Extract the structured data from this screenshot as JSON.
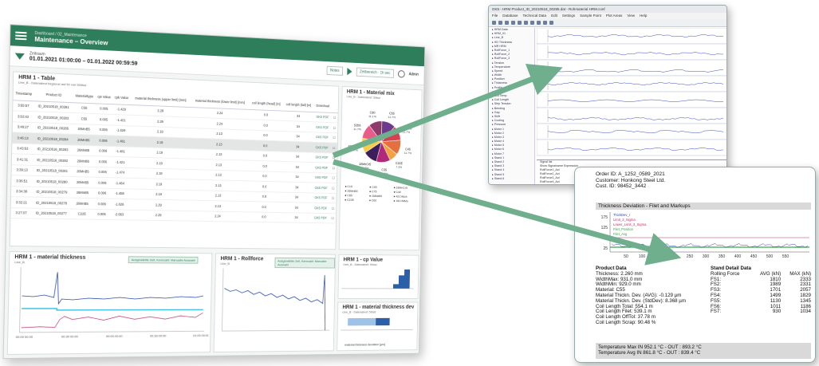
{
  "dashboard": {
    "topbar": {
      "subtitle": "Dashboard / 02_Maintenance",
      "title": "Maintenance – Overview"
    },
    "filter": {
      "label": "Zeitraum",
      "value": "01.01.2021 01:00:00 – 01.01.2022 00:59:59",
      "notes_label": "Notes",
      "time_label": "Zeitbereich · 1h sec",
      "user_label": "Admin"
    },
    "table_panel": {
      "title": "HRM 1 - Table",
      "subtitle": "Line_B - Datenabruf begrenzt auf 50 von 500tsd",
      "edit_label": "Bearbeiten",
      "columns": [
        "Timestamp",
        "Product ID",
        "Materialtype",
        "cpt Value",
        "cpk Value",
        "material thickness (upper limit) [mm]",
        "material thickness (lower limit) [mm]",
        "coil length (head) [m]",
        "coil length (tail) [m]",
        "Download",
        ""
      ],
      "rows": [
        [
          "3:55:57",
          "ID_20210518_00281",
          "C55",
          "0.005",
          "-1.429",
          "2.29",
          "2.24",
          "0.0",
          "34",
          "GK5 PDF",
          "☐"
        ],
        [
          "3:53:42",
          "ID_20210518_00283",
          "C55",
          "0.005",
          "-1.421",
          "2.29",
          "2.24",
          "0.0",
          "34",
          "GK5 PDF",
          "☐"
        ],
        [
          "3:48:27",
          "ID_20210518_00285",
          "26MnB5",
          "0.006",
          "-1.629",
          "2.19",
          "2.13",
          "0.0",
          "34",
          "GK5 PDF",
          "☐"
        ],
        [
          "3:46:13",
          "ID_20210518_00284",
          "26MnB5",
          "0.006",
          "-1.461",
          "2.19",
          "2.13",
          "0.0",
          "34",
          "GK5 PDF",
          "☐"
        ],
        [
          "3:43:53",
          "ID_20210518_00283",
          "26MnB5",
          "0.006",
          "-1.481",
          "2.19",
          "2.13",
          "0.0",
          "34",
          "GK5 PDF",
          "☐"
        ],
        [
          "3:41:31",
          "ID_20210518_00282",
          "26MnB5",
          "0.006",
          "-1.421",
          "2.19",
          "2.13",
          "0.0",
          "34",
          "GK5 PDF",
          "☐"
        ],
        [
          "3:39:13",
          "ID_20210518_00281",
          "26MnB5",
          "0.006",
          "-1.474",
          "2.19",
          "2.13",
          "0.0",
          "34",
          "GK5 PDF",
          "☐"
        ],
        [
          "3:36:51",
          "ID_20210518_00280",
          "26MnB5",
          "0.006",
          "-1.464",
          "2.19",
          "2.13",
          "0.0",
          "34",
          "GK5 PDF",
          "☐"
        ],
        [
          "3:34:38",
          "ID_20210518_00279",
          "26MnB5",
          "0.006",
          "-1.458",
          "2.19",
          "2.13",
          "0.0",
          "34",
          "GK5 PDF",
          "☐"
        ],
        [
          "3:32:21",
          "ID_20210518_00278",
          "26MnB5",
          "0.006",
          "-1.626",
          "2.29",
          "2.13",
          "0.0",
          "34",
          "GK5 PDF",
          "☐"
        ],
        [
          "3:27:07",
          "ID_20210518_00277",
          "C22E",
          "0.005",
          "-2.063",
          "2.29",
          "2.24",
          "0.0",
          "34",
          "GK5 PDF",
          "☐"
        ]
      ]
    },
    "pie_panel": {
      "title": "HRM 1 - Material mix",
      "subtitle": "Line_B - Datenabruf: 50tsd",
      "slices": [
        {
          "label": "C55",
          "value": 11.7,
          "color": "#6d3b8c"
        },
        {
          "label": "26MnB5",
          "value": 11.7,
          "color": "#d8404f"
        },
        {
          "label": "C45",
          "value": 11.7,
          "color": "#e66f3f"
        },
        {
          "label": "C22E",
          "value": 7.3,
          "color": "#f2a33f"
        },
        {
          "label": "C35",
          "value": 11.7,
          "color": "#b1287a"
        },
        {
          "label": "16MnCr5",
          "value": 11.7,
          "color": "#3c1f5a"
        },
        {
          "label": "42CrMo4",
          "value": 11.7,
          "color": "#f6cf4a"
        },
        {
          "label": "S355",
          "value": 11.7,
          "color": "#e85c8a"
        },
        {
          "label": "C60",
          "value": 11.1,
          "color": "#8e3b6b"
        }
      ],
      "legend": [
        "C15",
        "C45",
        "16MnCr5",
        "26MnB5",
        "C75",
        "C40",
        "C55",
        "16MnB5",
        "42CrMo4",
        "C22E",
        "C60",
        "18CrNiMo"
      ]
    },
    "mt_panel": {
      "title": "HRM 1 - material thickness",
      "subtitle": "Line_B",
      "filter_label": "Ausgewählte Zeit, Kennzahl: Manuelle Auswahl",
      "x_ticks": [
        "00:00 00:00",
        "00:30 00:00",
        "00:00 00:00",
        "00:30 00:00",
        "01:00 00:00"
      ]
    },
    "rf_panel": {
      "title": "HRM 1 - Rollforce",
      "subtitle": "Line_B",
      "filter_label": "Ausgewählte Zeit, Kennzahl: Manuelle Auswahl"
    },
    "cp_panel": {
      "title": "HRM 1 - cp Value",
      "subtitle": "Line_B - Datenabruf: 50tsd"
    },
    "td_panel": {
      "title": "HRM 1 - material thickness dev",
      "subtitle": "Line_B - Datenabruf: 50tsd",
      "legend": "material thickness deviation [µm]"
    }
  },
  "app_window": {
    "title": "GK5 - HRM Product_ID_20210518_00285.dat - Rohmaterial HRM.conf",
    "menu": [
      "File",
      "Database",
      "Technical Data",
      "Edit",
      "Settings",
      "Sample Point",
      "Plot Areas",
      "View",
      "Help"
    ],
    "tree_items": [
      "HRM Data",
      "HRM_01",
      "Line_B",
      "HD Thickness",
      "MR HRM",
      "RollForce_1",
      "RollForce_2",
      "RollForce_3",
      "Tension",
      "Temperature",
      "Speed",
      "Width",
      "Position",
      "Thickness",
      "Profile",
      "Flatness",
      "Exit Temp",
      "Coil Length",
      "Strip Tension",
      "Bending",
      "Gap",
      "Shift",
      "Cooling",
      "Pressure",
      "Motor 1",
      "Motor 2",
      "Motor 3",
      "Motor 4",
      "Motor 5",
      "Motor 6",
      "Motor 7",
      "Stand 1",
      "Stand 2",
      "Stand 3",
      "Stand 4",
      "Stand 5",
      "Stand 6"
    ],
    "signal_table": [
      "Signal list",
      "Show  Signalname  Expression",
      "RollForce1_Act",
      "RollForce2_Act",
      "RollForce3_Act",
      "RollForce4_Act"
    ]
  },
  "report": {
    "order_id": "Order ID: A_1252_0589_2021",
    "customer": "Customer: Honkong Steel Ltd.",
    "cust_id": "Cust. ID: 98452_3442",
    "section_title": "Thickness Deviation - Filet and Markups",
    "chart": {
      "y_ticks": [
        "175",
        "125",
        "75",
        "25"
      ],
      "x_ticks": [
        "50",
        "100",
        "150",
        "200",
        "250",
        "300",
        "350",
        "400",
        "450",
        "500",
        "550"
      ],
      "legend": [
        "ThickDev_I",
        "Limit_3_Sigma",
        "Lower_Limit_3_Sigma",
        "Filet_Position",
        "Filet_Avg",
        "Filet"
      ]
    },
    "product_data": {
      "title": "Product Data",
      "lines": [
        "Thickness: 2.260 mm",
        "WidthMax: 931.0 mm",
        "WidthMin: 929.0 mm",
        "Material: C55",
        "Material Thickn. Dev. (AVG): -0.129 µm",
        "Material Thickn. Dev. (StdDev): 8.368 µm",
        "Coil Length Total: 554.1 m",
        "Coil Length Filet: 539.1 m",
        "Coil Length OffTol: 37.78 m",
        "Coil Length Scrap: 90.48 %"
      ]
    },
    "stand_data": {
      "title": "Stand Detail Data",
      "headers": [
        "Rolling Force",
        "AVG (kN)",
        "MAX (kN)"
      ],
      "rows": [
        [
          "FS1:",
          "1810",
          "2333"
        ],
        [
          "FS2:",
          "1989",
          "2331"
        ],
        [
          "FS3:",
          "1701",
          "2057"
        ],
        [
          "FS4:",
          "1499",
          "1829"
        ],
        [
          "FS5:",
          "1130",
          "1345"
        ],
        [
          "FS6:",
          "1011",
          "1186"
        ],
        [
          "FS7:",
          "930",
          "1034"
        ]
      ]
    },
    "temp_max": "Temperature Max IN 952.1 °C - OUT : 893.2 °C",
    "temp_avg": "Temperature Avg IN 861.8 °C - OUT : 839.4 °C"
  },
  "colors": {
    "brand_green": "#2e7d5b",
    "arrow_green": "#6faf8d"
  }
}
